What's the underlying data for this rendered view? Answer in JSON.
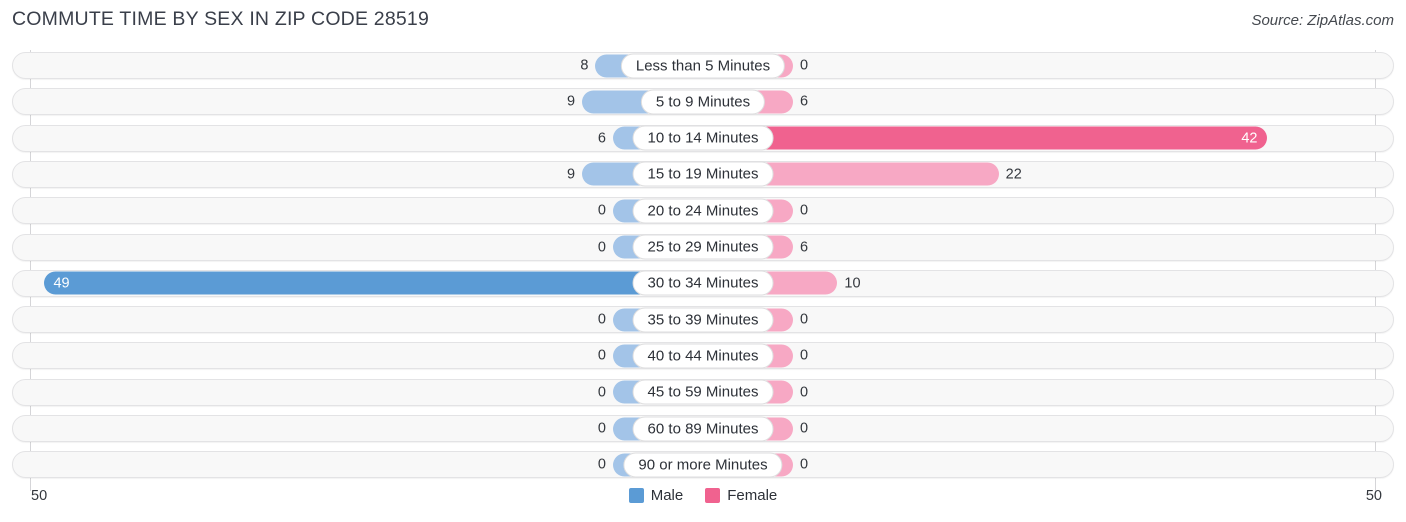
{
  "header": {
    "title": "COMMUTE TIME BY SEX IN ZIP CODE 28519",
    "source": "Source: ZipAtlas.com"
  },
  "axis": {
    "left_tick": "50",
    "right_tick": "50",
    "max": 50
  },
  "legend": {
    "items": [
      {
        "label": "Male",
        "color": "#5b9bd5"
      },
      {
        "label": "Female",
        "color": "#f0628f"
      }
    ]
  },
  "colors": {
    "male_light": "#a3c4e8",
    "male_strong": "#5b9bd5",
    "female_light": "#f7a8c4",
    "female_strong": "#f0628f",
    "track": "#f8f8f8",
    "title": "#3a3f4a"
  },
  "chart_data": {
    "type": "bar",
    "title": "COMMUTE TIME BY SEX IN ZIP CODE 28519",
    "subtitle": "Source: ZipAtlas.com",
    "orientation": "horizontal-diverging",
    "xlabel": "",
    "ylabel": "",
    "xlim": [
      50,
      50
    ],
    "grid": false,
    "legend_position": "bottom-center",
    "categories": [
      "Less than 5 Minutes",
      "5 to 9 Minutes",
      "10 to 14 Minutes",
      "15 to 19 Minutes",
      "20 to 24 Minutes",
      "25 to 29 Minutes",
      "30 to 34 Minutes",
      "35 to 39 Minutes",
      "40 to 44 Minutes",
      "45 to 59 Minutes",
      "60 to 89 Minutes",
      "90 or more Minutes"
    ],
    "series": [
      {
        "name": "Male",
        "side": "left",
        "values": [
          8,
          9,
          6,
          9,
          0,
          0,
          49,
          0,
          0,
          0,
          0,
          0
        ]
      },
      {
        "name": "Female",
        "side": "right",
        "values": [
          0,
          6,
          42,
          22,
          0,
          6,
          10,
          0,
          0,
          0,
          0,
          0
        ]
      }
    ]
  },
  "rows": [
    {
      "category": "Less than 5 Minutes",
      "male": "8",
      "female": "0"
    },
    {
      "category": "5 to 9 Minutes",
      "male": "9",
      "female": "6"
    },
    {
      "category": "10 to 14 Minutes",
      "male": "6",
      "female": "42"
    },
    {
      "category": "15 to 19 Minutes",
      "male": "9",
      "female": "22"
    },
    {
      "category": "20 to 24 Minutes",
      "male": "0",
      "female": "0"
    },
    {
      "category": "25 to 29 Minutes",
      "male": "0",
      "female": "6"
    },
    {
      "category": "30 to 34 Minutes",
      "male": "49",
      "female": "10"
    },
    {
      "category": "35 to 39 Minutes",
      "male": "0",
      "female": "0"
    },
    {
      "category": "40 to 44 Minutes",
      "male": "0",
      "female": "0"
    },
    {
      "category": "45 to 59 Minutes",
      "male": "0",
      "female": "0"
    },
    {
      "category": "60 to 89 Minutes",
      "male": "0",
      "female": "0"
    },
    {
      "category": "90 or more Minutes",
      "male": "0",
      "female": "0"
    }
  ]
}
